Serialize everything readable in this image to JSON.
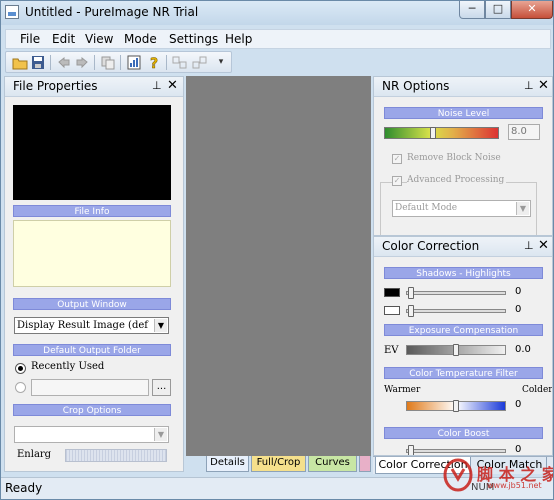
{
  "window": {
    "title": "Untitled - PureImage NR Trial",
    "min": "─",
    "max": "□",
    "close": "✕"
  },
  "menu": [
    "File",
    "Edit",
    "View",
    "Mode",
    "Settings",
    "Help"
  ],
  "file_properties": {
    "title": "File Properties",
    "file_info": "File Info",
    "output_window": "Output Window",
    "output_window_value": "Display Result Image (def",
    "default_output_folder": "Default Output Folder",
    "recently_used": "Recently Used",
    "browse": "...",
    "crop_options": "Crop Options",
    "enlarge": "Enlarg"
  },
  "nr_options": {
    "title": "NR Options",
    "noise_level": "Noise Level",
    "noise_value": "8.0",
    "noise_slider_fraction": 0.42,
    "remove_block_noise": "Remove Block Noise",
    "advanced_processing": "Advanced Processing",
    "mode": "Default Mode"
  },
  "color_correction": {
    "title": "Color Correction",
    "shadows_highlights": "Shadows - Highlights",
    "shadows_value": "0",
    "highlights_value": "0",
    "exposure_compensation": "Exposure Compensation",
    "ev_label": "EV",
    "ev_value": "0.0",
    "color_temperature": "Color Temperature Filter",
    "warmer": "Warmer",
    "colder": "Colder",
    "temp_value": "0",
    "color_boost": "Color Boost",
    "boost_value": "0"
  },
  "tabs": [
    "Details",
    "Full/Crop",
    "Curves"
  ],
  "right_tabs": [
    "Color Correction",
    "Color Match"
  ],
  "status": {
    "text": "Ready",
    "num": "NUM"
  },
  "watermark": {
    "text": "脚 本 之 家",
    "url": "www.jb51.net"
  },
  "colors": {
    "accent": "#9aa6e8",
    "workspace": "#7f7f7f",
    "info_bg": "#ffffe0"
  }
}
